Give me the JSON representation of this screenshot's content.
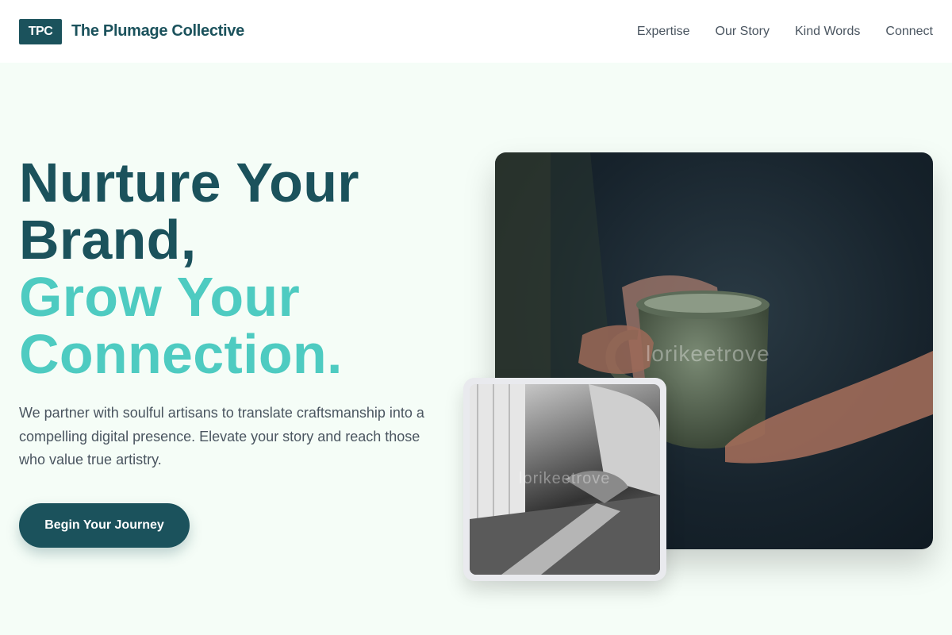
{
  "header": {
    "logo_badge": "TPC",
    "brand_name": "The Plumage Collective",
    "nav": [
      "Expertise",
      "Our Story",
      "Kind Words",
      "Connect"
    ]
  },
  "hero": {
    "headline_line1": "Nurture Your",
    "headline_line2": "Brand,",
    "headline_line3": "Grow Your",
    "headline_line4": "Connection.",
    "lead": "We partner with soulful artisans to translate craftsmanship into a compelling digital presence. Elevate your story and reach those who value true artistry.",
    "cta": "Begin Your Journey",
    "image_watermark": "lorikeetrove",
    "inset_watermark": "lorikeetrove"
  },
  "colors": {
    "primary": "#1b525c",
    "accent": "#4ecbc1",
    "background": "#f5fdf7"
  }
}
